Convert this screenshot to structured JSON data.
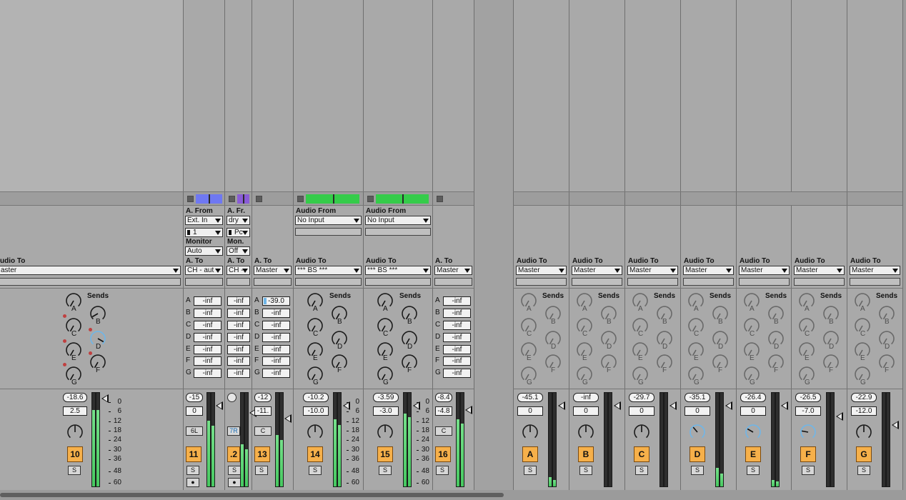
{
  "left_strip": {
    "audio_to_label": "udio To",
    "audio_to_value": "aster",
    "sends_label": "Sends",
    "volume": "-18.6",
    "pan": "2.5",
    "number": "10",
    "solo": "S",
    "meter_scale": [
      "0",
      "6",
      "12",
      "18",
      "24",
      "30",
      "36",
      "48",
      "60"
    ]
  },
  "tracks": [
    {
      "id": "11",
      "from_label": "A. From",
      "from_value": "Ext. In",
      "channel": "1",
      "monitor_label": "Monitor",
      "monitor_value": "Auto",
      "to_label": "A. To",
      "to_value": "CH - aut",
      "sends": [
        "-inf",
        "-inf",
        "-inf",
        "-inf",
        "-inf",
        "-inf",
        "-inf"
      ],
      "volume": "-15",
      "pan": "0",
      "pan_mode": "6L",
      "number": "11",
      "solo": "S",
      "arm": "●"
    },
    {
      "id": "12",
      "from_label": "A. Fr.",
      "from_value": "dry",
      "channel": "Pc",
      "monitor_label": "Mon.",
      "monitor_value": "Off",
      "to_label": "A. To",
      "to_value": "CH -",
      "sends": [
        "-inf",
        "-inf",
        "-inf",
        "-inf",
        "-inf",
        "-inf",
        "-inf"
      ],
      "volume": "",
      "pan": "",
      "pan_mode": "7R",
      "number": ".2",
      "solo": "S",
      "arm": "●"
    },
    {
      "id": "13",
      "to_label": "A. To",
      "to_value": "Master",
      "sends": [
        "-39.0",
        "-inf",
        "-inf",
        "-inf",
        "-inf",
        "-inf",
        "-inf"
      ],
      "volume": "-12",
      "pan": "-11.",
      "pan_mode": "C",
      "number": "13",
      "solo": "S"
    },
    {
      "id": "14",
      "from_label": "Audio From",
      "from_value": "No Input",
      "to_label": "Audio To",
      "to_value": "*** BS ***",
      "sends_label": "Sends",
      "volume": "-10.2",
      "pan": "-10.0",
      "number": "14",
      "solo": "S"
    },
    {
      "id": "15",
      "from_label": "Audio From",
      "from_value": "No Input",
      "to_label": "Audio To",
      "to_value": "*** BS ***",
      "sends_label": "Sends",
      "volume": "-3.59",
      "pan": "-3.0",
      "number": "15",
      "solo": "S"
    },
    {
      "id": "16",
      "to_label": "A. To",
      "to_value": "Master",
      "sends": [
        "-inf",
        "-inf",
        "-inf",
        "-inf",
        "-inf",
        "-inf",
        "-inf"
      ],
      "volume": "-8.4",
      "pan": "-4.8",
      "pan_mode": "C",
      "number": "16",
      "solo": "S"
    }
  ],
  "send_letters": [
    "A",
    "B",
    "C",
    "D",
    "E",
    "F",
    "G"
  ],
  "meter_scale": [
    "0",
    "6",
    "12",
    "18",
    "24",
    "30",
    "36",
    "48",
    "60"
  ],
  "returns": [
    {
      "id": "A",
      "to_label": "Audio To",
      "to_value": "Master",
      "sends_label": "Sends",
      "volume": "-45.1",
      "pan": "0",
      "number": "A",
      "solo": "S"
    },
    {
      "id": "B",
      "to_label": "Audio To",
      "to_value": "Master",
      "sends_label": "Sends",
      "volume": "-inf",
      "pan": "0",
      "number": "B",
      "solo": "S"
    },
    {
      "id": "C",
      "to_label": "Audio To",
      "to_value": "Master",
      "sends_label": "Sends",
      "volume": "-29.7",
      "pan": "0",
      "number": "C",
      "solo": "S"
    },
    {
      "id": "D",
      "to_label": "Audio To",
      "to_value": "Master",
      "sends_label": "Sends",
      "volume": "-35.1",
      "pan": "0",
      "number": "D",
      "solo": "S"
    },
    {
      "id": "E",
      "to_label": "Audio To",
      "to_value": "Master",
      "sends_label": "Sends",
      "volume": "-26.4",
      "pan": "0",
      "number": "E",
      "solo": "S"
    },
    {
      "id": "F",
      "to_label": "Audio To",
      "to_value": "Master",
      "sends_label": "Sends",
      "volume": "-26.5",
      "pan": "-7.0",
      "number": "F",
      "solo": "S"
    },
    {
      "id": "G",
      "to_label": "Audio To",
      "to_value": "Master",
      "sends_label": "Sends",
      "volume": "-22.9",
      "pan": "-12.0",
      "number": "G",
      "solo": "S"
    }
  ],
  "colors": {
    "accent_orange": "#f6b04a",
    "meter_green": "#5ed273",
    "clip_blue": "#6f78f2",
    "clip_purple": "#8a5cd6",
    "clip_green": "#35cc4a",
    "knob_highlight": "#6fb6e8"
  }
}
